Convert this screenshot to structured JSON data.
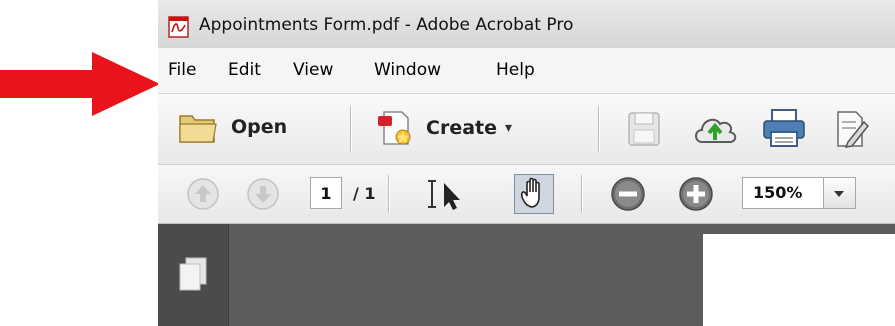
{
  "window": {
    "title": "Appointments Form.pdf - Adobe Acrobat Pro",
    "icon": "pdf-file-icon"
  },
  "menu": {
    "items": [
      "File",
      "Edit",
      "View",
      "Window",
      "Help"
    ]
  },
  "toolbar": {
    "open_label": "Open",
    "create_label": "Create",
    "create_dropdown": "▾",
    "icons": [
      "folder-icon",
      "create-pdf-icon",
      "save-icon",
      "cloud-upload-icon",
      "print-icon",
      "edit-icon"
    ]
  },
  "navigation": {
    "current_page": "1",
    "total_pages": "/ 1",
    "zoom": "150%"
  },
  "colors": {
    "arrow": "#e8131b",
    "content_bg": "#5c5c5c"
  }
}
